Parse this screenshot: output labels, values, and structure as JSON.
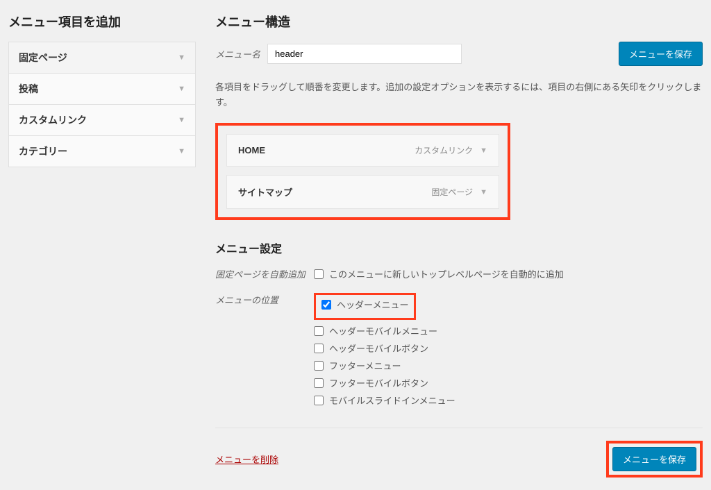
{
  "left": {
    "title": "メニュー項目を追加",
    "panels": [
      "固定ページ",
      "投稿",
      "カスタムリンク",
      "カテゴリー"
    ]
  },
  "right": {
    "title": "メニュー構造",
    "menu_name_label": "メニュー名",
    "menu_name_value": "header",
    "save_btn": "メニューを保存",
    "description": "各項目をドラッグして順番を変更します。追加の設定オプションを表示するには、項目の右側にある矢印をクリックします。",
    "items": [
      {
        "title": "HOME",
        "type": "カスタムリンク"
      },
      {
        "title": "サイトマップ",
        "type": "固定ページ"
      }
    ],
    "settings": {
      "heading": "メニュー設定",
      "auto_add_label": "固定ページを自動追加",
      "auto_add_text": "このメニューに新しいトップレベルページを自動的に追加",
      "location_label": "メニューの位置",
      "locations": [
        {
          "text": "ヘッダーメニュー",
          "checked": true,
          "highlight": true
        },
        {
          "text": "ヘッダーモバイルメニュー",
          "checked": false
        },
        {
          "text": "ヘッダーモバイルボタン",
          "checked": false
        },
        {
          "text": "フッターメニュー",
          "checked": false
        },
        {
          "text": "フッターモバイルボタン",
          "checked": false
        },
        {
          "text": "モバイルスライドインメニュー",
          "checked": false
        }
      ]
    },
    "delete_text": "メニューを削除",
    "save_btn_bottom": "メニューを保存"
  }
}
